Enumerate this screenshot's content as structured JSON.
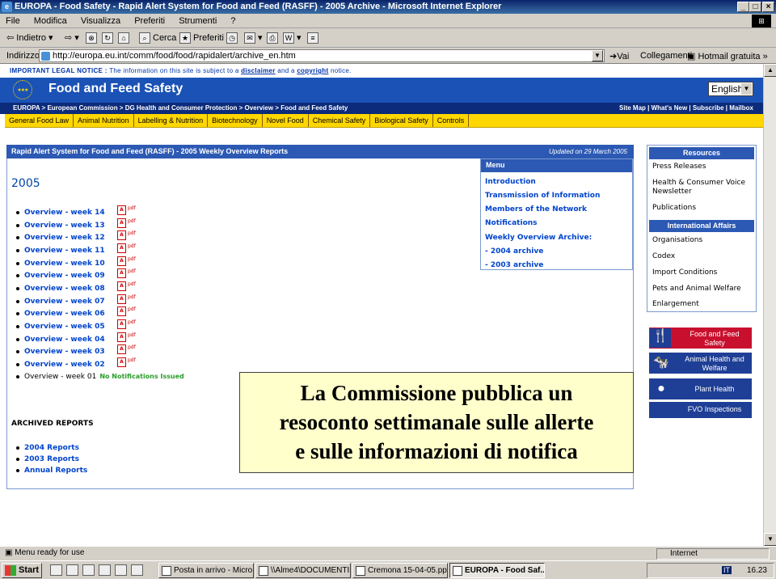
{
  "window": {
    "title": "EUROPA - Food Safety - Rapid Alert System for Food and Feed (RASFF) - 2005 Archive - Microsoft Internet Explorer"
  },
  "menubar": [
    "File",
    "Modifica",
    "Visualizza",
    "Preferiti",
    "Strumenti",
    "?"
  ],
  "toolbar": {
    "back": "Indietro",
    "search": "Cerca",
    "favorites": "Preferiti"
  },
  "address": {
    "label": "Indirizzo",
    "url": "http://europa.eu.int/comm/food/food/rapidalert/archive_en.htm",
    "go": "Vai",
    "links": "Collegamenti",
    "hotmail": "Hotmail gratuita"
  },
  "page": {
    "legal": {
      "prefix": "IMPORTANT LEGAL NOTICE :",
      "mid": "The information on this site is subject to a",
      "disclaimer": "disclaimer",
      "and": "and a",
      "copyright": "copyright",
      "suffix": "notice."
    },
    "site_title": "Food and Feed Safety",
    "language": "English",
    "breadcrumb": "EUROPA > European Commission > DG Health and Consumer Protection > Overview > Food and Feed Safety",
    "crumb_right": "Site Map | What's New | Subscribe | Mailbox",
    "topnav": [
      "General Food Law",
      "Animal Nutrition",
      "Labelling & Nutrition",
      "Biotechnology",
      "Novel Food",
      "Chemical Safety",
      "Biological Safety",
      "Controls"
    ],
    "main_heading": "Rapid Alert System for Food and Feed (RASFF) - 2005 Weekly Overview Reports",
    "updated": "Updated on 29 March 2005",
    "year": "2005",
    "pdf_label": "pdf",
    "weeks": [
      "Overview - week 14",
      "Overview - week 13",
      "Overview - week 12",
      "Overview - week 11",
      "Overview - week 10",
      "Overview - week 09",
      "Overview - week 08",
      "Overview - week 07",
      "Overview - week 06",
      "Overview - week 05",
      "Overview - week 04",
      "Overview - week 03",
      "Overview - week 02"
    ],
    "week01": "Overview - week 01",
    "no_notifications": "No Notifications Issued",
    "archived_heading": "ARCHIVED REPORTS",
    "archived": [
      "2004 Reports",
      "2003 Reports",
      "Annual Reports"
    ],
    "menu": {
      "heading": "Menu",
      "items": [
        "Introduction",
        "Transmission of Information",
        "Members of the Network",
        "Notifications",
        "Weekly Overview Archive:",
        "-  2004 archive",
        "-  2003 archive"
      ]
    },
    "resources": {
      "heading": "Resources",
      "items": [
        "Press Releases",
        "Health & Consumer Voice Newsletter",
        "Publications"
      ]
    },
    "international": {
      "heading": "International Affairs",
      "items": [
        "Organisations",
        "Codex",
        "Import Conditions",
        "Pets and Animal Welfare",
        "Enlargement"
      ]
    },
    "tiles": [
      "Food and Feed Safety",
      "Animal Health and Welfare",
      "Plant Health",
      "FVO Inspections"
    ],
    "overlay": [
      "La Commissione pubblica un",
      "resoconto settimanale sulle allerte",
      "e sulle informazioni di notifica"
    ]
  },
  "status": {
    "left": "Menu ready for use",
    "zone": "Internet"
  },
  "taskbar": {
    "start": "Start",
    "tasks": [
      "Posta in arrivo - Micro...",
      "\\\\Alme4\\DOCUMENTI...",
      "Cremona 15-04-05.ppt",
      "EUROPA - Food Saf..."
    ],
    "lang": "IT",
    "clock": "16.23"
  }
}
